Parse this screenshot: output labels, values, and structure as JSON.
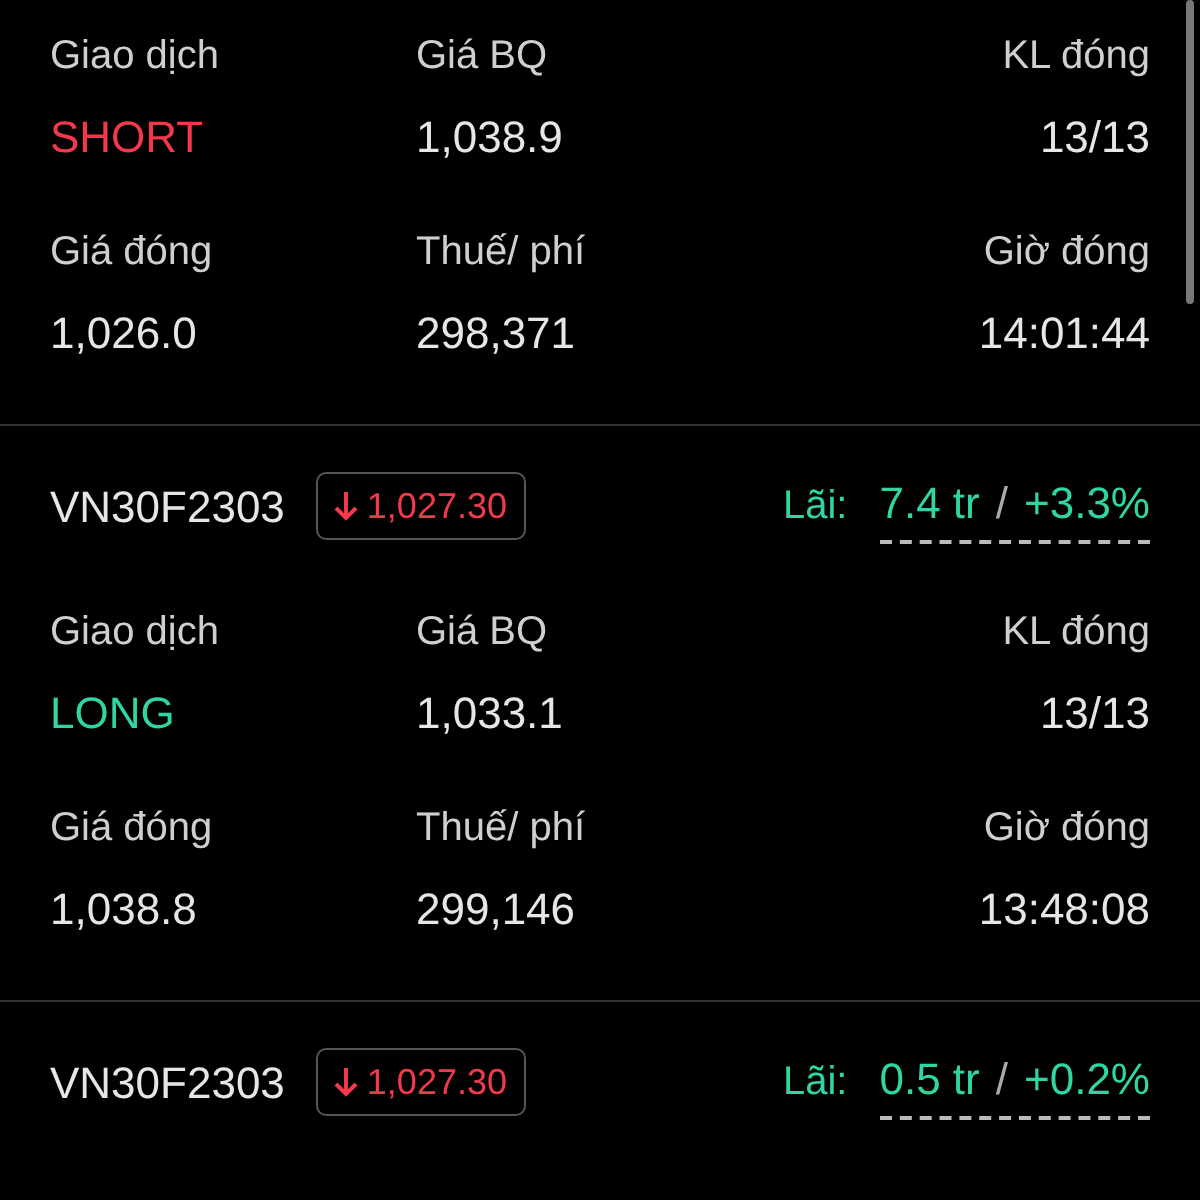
{
  "trades": [
    {
      "fields": [
        {
          "label": "Giao dịch",
          "value": "SHORT",
          "kind": "side",
          "short": true
        },
        {
          "label": "Giá BQ",
          "value": "1,038.9",
          "kind": "plain"
        },
        {
          "label": "KL đóng",
          "value": "13/13",
          "kind": "plain"
        },
        {
          "label": "Giá đóng",
          "value": "1,026.0",
          "kind": "plain"
        },
        {
          "label": "Thuế/ phí",
          "value": "298,371",
          "kind": "plain"
        },
        {
          "label": "Giờ đóng",
          "value": "14:01:44",
          "kind": "plain"
        }
      ]
    },
    {
      "symbol": "VN30F2303",
      "price": {
        "value": "1,027.30",
        "falling": true
      },
      "profit": {
        "label": "Lãi:",
        "amount": "7.4 tr",
        "separator": "/",
        "percent": "+3.3%"
      },
      "fields": [
        {
          "label": "Giao dịch",
          "value": "LONG",
          "kind": "side",
          "short": false
        },
        {
          "label": "Giá BQ",
          "value": "1,033.1",
          "kind": "plain"
        },
        {
          "label": "KL đóng",
          "value": "13/13",
          "kind": "plain"
        },
        {
          "label": "Giá đóng",
          "value": "1,038.8",
          "kind": "plain"
        },
        {
          "label": "Thuế/ phí",
          "value": "299,146",
          "kind": "plain"
        },
        {
          "label": "Giờ đóng",
          "value": "13:48:08",
          "kind": "plain"
        }
      ]
    },
    {
      "symbol": "VN30F2303",
      "price": {
        "value": "1,027.30",
        "falling": true
      },
      "profit": {
        "label": "Lãi:",
        "amount": "0.5 tr",
        "separator": "/",
        "percent": "+0.2%"
      }
    }
  ]
}
